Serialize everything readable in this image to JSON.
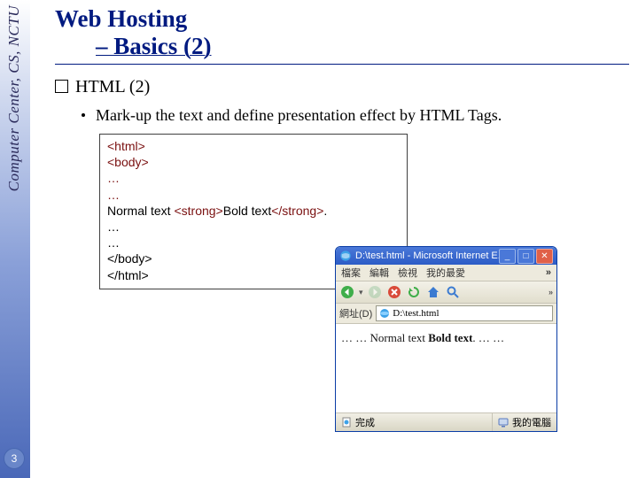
{
  "sidebar": {
    "org": "Computer Center, CS, NCTU",
    "page": "3"
  },
  "title": {
    "line1": "Web Hosting",
    "line2": "– Basics (2)"
  },
  "section": {
    "heading": "HTML (2)",
    "bullet": "Mark-up the text and define presentation effect by HTML Tags."
  },
  "code": {
    "l1": "<html>",
    "l2": "<body>",
    "l3": "…",
    "l4": "…",
    "l5a": "Normal text ",
    "l5b": "<strong>",
    "l5c": "Bold text",
    "l5d": "</strong>",
    "l5e": ".",
    "l6": "…",
    "l7": "…",
    "l8": "</body>",
    "l9": "</html>"
  },
  "browser": {
    "title": "D:\\test.html - Microsoft Internet E...",
    "menu": {
      "m1": "檔案",
      "m2": "編輯",
      "m3": "檢視",
      "m4": "我的最愛",
      "chevron": "»"
    },
    "toolbar_chevron": "»",
    "address_label": "網址(D)",
    "address_value": "D:\\test.html",
    "body_prefix": "… … Normal text ",
    "body_bold": "Bold text",
    "body_suffix": ". … …",
    "status_done": "完成",
    "status_zone": "我的電腦",
    "win": {
      "min": "_",
      "max": "□",
      "close": "✕"
    }
  }
}
